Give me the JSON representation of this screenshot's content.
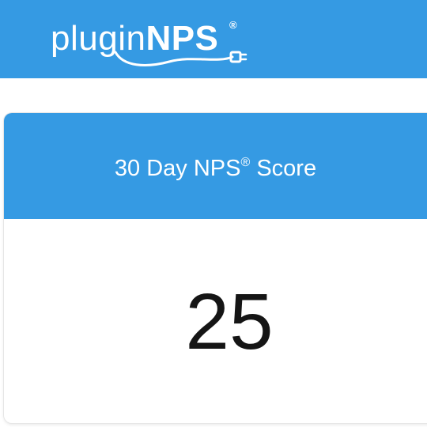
{
  "brand": {
    "logo_light": "plugin",
    "logo_bold": "NPS",
    "logo_mark": "®",
    "color_primary": "#359ae3"
  },
  "card": {
    "title": "30 Day NPS",
    "title_mark": "®",
    "title_suffix": " Score",
    "score": "25"
  }
}
